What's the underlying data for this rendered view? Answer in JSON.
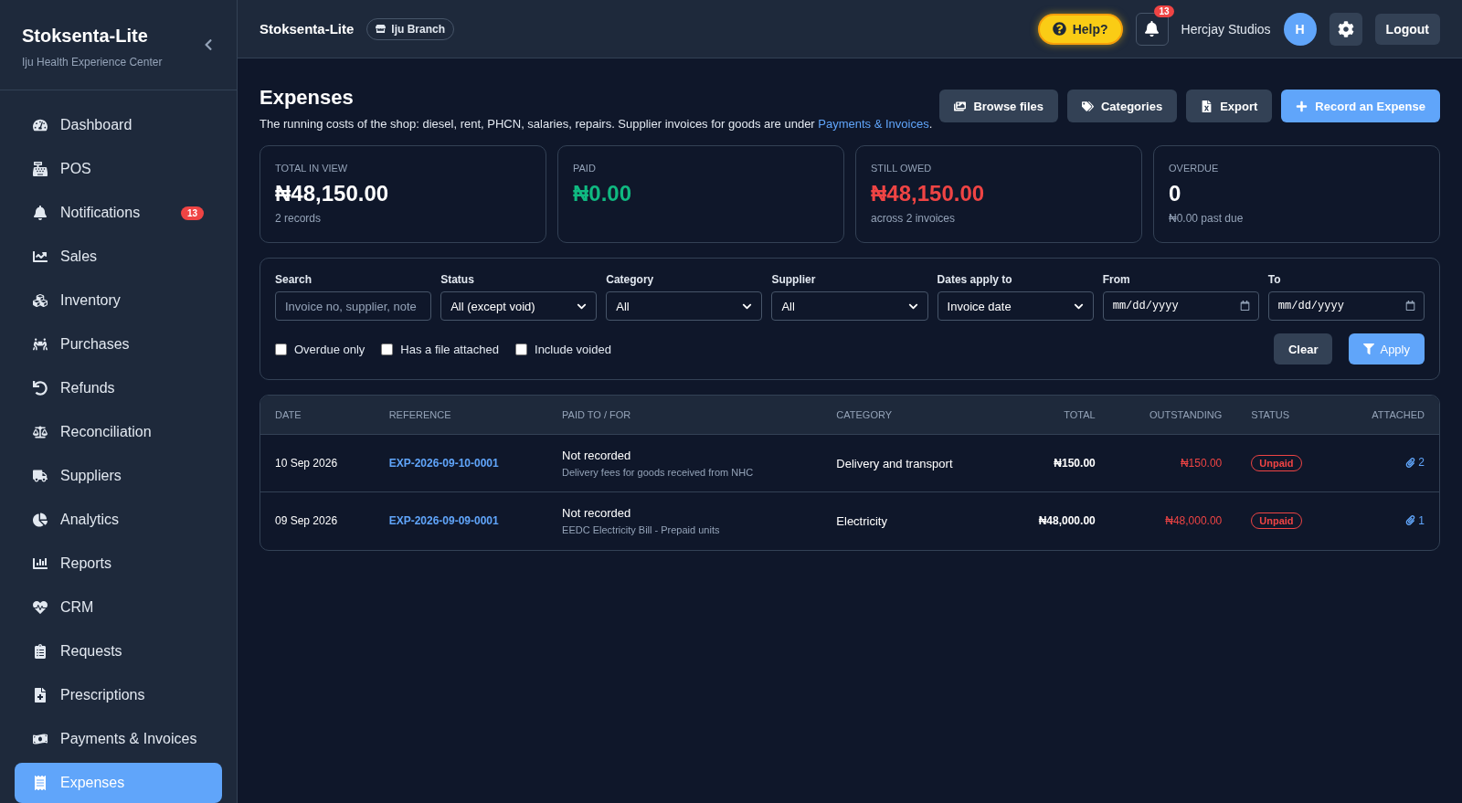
{
  "sidebar": {
    "title": "Stoksenta-Lite",
    "subtitle": "Iju Health Experience Center",
    "items": [
      {
        "label": "Dashboard",
        "selected": false
      },
      {
        "label": "POS",
        "selected": false
      },
      {
        "label": "Notifications",
        "selected": false,
        "badge": "13"
      },
      {
        "label": "Sales",
        "selected": false
      },
      {
        "label": "Inventory",
        "selected": false
      },
      {
        "label": "Purchases",
        "selected": false
      },
      {
        "label": "Refunds",
        "selected": false
      },
      {
        "label": "Reconciliation",
        "selected": false
      },
      {
        "label": "Suppliers",
        "selected": false
      },
      {
        "label": "Analytics",
        "selected": false
      },
      {
        "label": "Reports",
        "selected": false
      },
      {
        "label": "CRM",
        "selected": false
      },
      {
        "label": "Requests",
        "selected": false
      },
      {
        "label": "Prescriptions",
        "selected": false
      },
      {
        "label": "Payments & Invoices",
        "selected": false
      },
      {
        "label": "Expenses",
        "selected": true
      }
    ]
  },
  "topbar": {
    "title": "Stoksenta-Lite",
    "branch": "Iju Branch",
    "help": "Help?",
    "notification_count": "13",
    "user": "Hercjay Studios",
    "avatar": "H",
    "logout": "Logout"
  },
  "page": {
    "title": "Expenses",
    "description_before": "The running costs of the shop: diesel, rent, PHCN, salaries, repairs. Supplier invoices for goods are under ",
    "description_link": "Payments & Invoices",
    "description_after": ".",
    "actions": [
      {
        "label": "Browse files",
        "kind": "secondary"
      },
      {
        "label": "Categories",
        "kind": "secondary"
      },
      {
        "label": "Export",
        "kind": "secondary"
      },
      {
        "label": "Record an Expense",
        "kind": "primary"
      }
    ]
  },
  "stats": [
    {
      "label": "TOTAL IN VIEW",
      "value": "₦48,150.00",
      "note": "2 records",
      "color": "#ffffff"
    },
    {
      "label": "PAID",
      "value": "₦0.00",
      "color": "#10b981"
    },
    {
      "label": "STILL OWED",
      "value": "₦48,150.00",
      "note": "across 2 invoices",
      "color": "#ef4444"
    },
    {
      "label": "OVERDUE",
      "value": "0",
      "note": "₦0.00 past due",
      "color": "#ffffff"
    }
  ],
  "filters": {
    "fields": [
      {
        "label": "Search",
        "kind": "text",
        "placeholder": "Invoice no, supplier, note"
      },
      {
        "label": "Status",
        "kind": "select",
        "value": "All (except void)"
      },
      {
        "label": "Category",
        "kind": "select",
        "value": "All"
      },
      {
        "label": "Supplier",
        "kind": "select",
        "value": "All"
      },
      {
        "label": "Dates apply to",
        "kind": "select",
        "value": "Invoice date"
      },
      {
        "label": "From",
        "kind": "date",
        "placeholder": "mm/dd/yyyy"
      },
      {
        "label": "To",
        "kind": "date",
        "placeholder": "mm/dd/yyyy"
      }
    ],
    "checkboxes": [
      {
        "label": "Overdue only",
        "checked": false
      },
      {
        "label": "Has a file attached",
        "checked": false
      },
      {
        "label": "Include voided",
        "checked": false
      }
    ],
    "clear": "Clear",
    "apply": "Apply"
  },
  "table": {
    "columns": [
      "DATE",
      "REFERENCE",
      "PAID TO / FOR",
      "CATEGORY",
      "TOTAL",
      "OUTSTANDING",
      "STATUS",
      "ATTACHED"
    ],
    "rows": [
      {
        "date": "10 Sep 2026",
        "reference": "EXP-2026-09-10-0001",
        "paid_to": "Not recorded",
        "note": "Delivery fees for goods received from NHC",
        "category": "Delivery and transport",
        "total": "₦150.00",
        "outstanding": "₦150.00",
        "status": "Unpaid",
        "attached": "2"
      },
      {
        "date": "09 Sep 2026",
        "reference": "EXP-2026-09-09-0001",
        "paid_to": "Not recorded",
        "note": "EEDC Electricity Bill - Prepaid units",
        "category": "Electricity",
        "total": "₦48,000.00",
        "outstanding": "₦48,000.00",
        "status": "Unpaid",
        "attached": "1"
      }
    ]
  }
}
